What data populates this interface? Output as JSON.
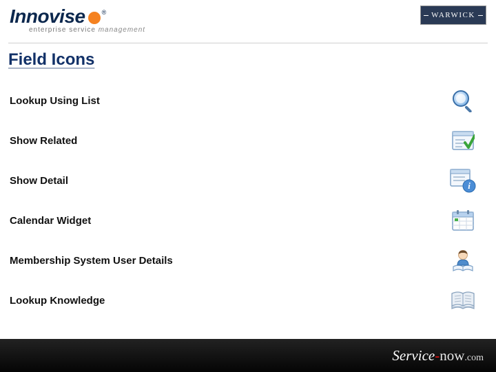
{
  "header": {
    "brand_text": "Innovise",
    "brand_subtext_prefix": "enterprise service ",
    "brand_subtext_suffix": "management",
    "partner_badge": "WARWICK"
  },
  "title": "Field Icons",
  "rows": [
    {
      "label": "Lookup Using List",
      "icon": "magnifier-icon"
    },
    {
      "label": "Show Related",
      "icon": "related-check-icon"
    },
    {
      "label": "Show Detail",
      "icon": "detail-info-icon"
    },
    {
      "label": "Calendar Widget",
      "icon": "calendar-icon"
    },
    {
      "label": "Membership System User Details",
      "icon": "user-book-icon"
    },
    {
      "label": "Lookup Knowledge",
      "icon": "knowledge-book-icon"
    }
  ],
  "footer": {
    "brand_s": "Service",
    "brand_dash": "-",
    "brand_now": "now",
    "brand_com": ".com"
  }
}
